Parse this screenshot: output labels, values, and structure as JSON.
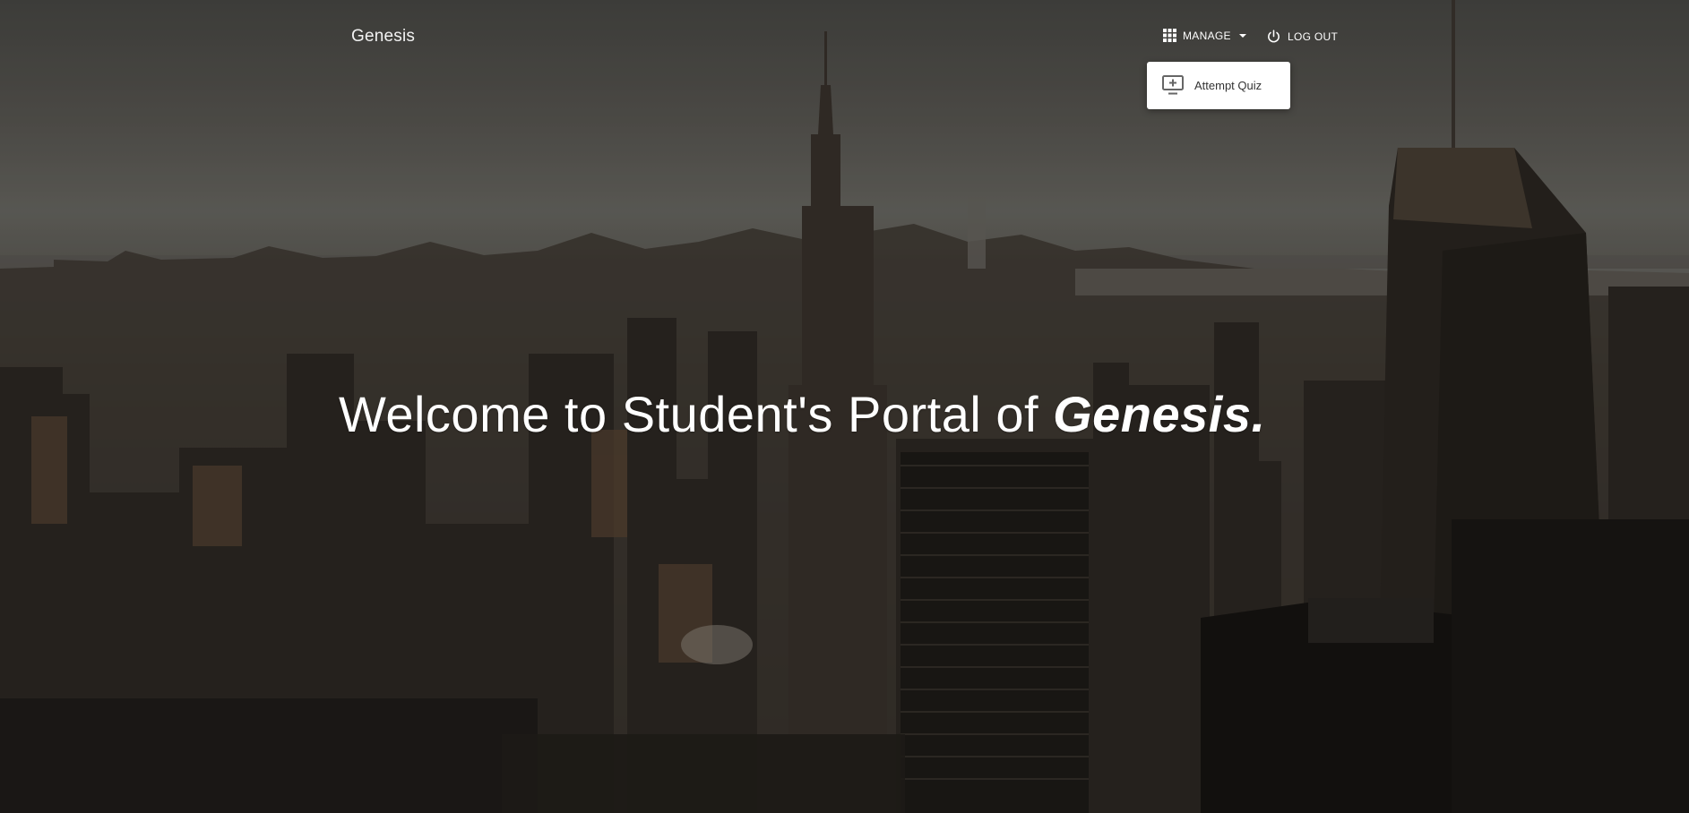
{
  "navbar": {
    "brand": "Genesis",
    "manage_label": "MANAGE",
    "logout_label": "LOG OUT"
  },
  "dropdown": {
    "items": [
      {
        "label": "Attempt Quiz",
        "icon": "add-to-queue-icon"
      }
    ]
  },
  "hero": {
    "headline_prefix": "Welcome to Student's Portal of ",
    "headline_brand": "Genesis."
  },
  "colors": {
    "dropdown_bg": "#ffffff",
    "text_primary": "#ffffff",
    "dropdown_text": "#333333"
  },
  "background": {
    "description_icon": "city-skyline-photo"
  }
}
